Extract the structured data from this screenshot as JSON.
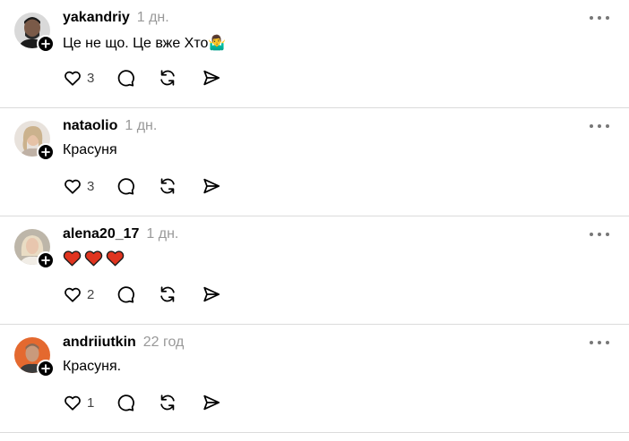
{
  "posts": [
    {
      "username": "yakandriy",
      "time": "1 дн.",
      "text": "Це не що. Це вже Хто🤷‍♂️",
      "likes": "3",
      "avatar": "man-dark-hair",
      "avatar_color": "#2b2b2b"
    },
    {
      "username": "nataolio",
      "time": "1 дн.",
      "text": "Красуня",
      "likes": "3",
      "avatar": "blonde-woman",
      "avatar_color": "#cdbfb3"
    },
    {
      "username": "alena20_17",
      "time": "1 дн.",
      "text": "❤❤❤",
      "hearts": 3,
      "heart_color": "#e0341f",
      "likes": "2",
      "avatar": "woman-light-hair",
      "avatar_color": "#c9c2b6"
    },
    {
      "username": "andriiutkin",
      "time": "22 год",
      "text": "Красуня.",
      "likes": "1",
      "avatar": "man-orange-background",
      "avatar_color": "#e4692f"
    }
  ],
  "icons": {
    "like": "heart-icon",
    "reply": "comment-icon",
    "repost": "repost-icon",
    "share": "send-icon",
    "more": "more-dots-icon",
    "follow": "plus-icon"
  }
}
